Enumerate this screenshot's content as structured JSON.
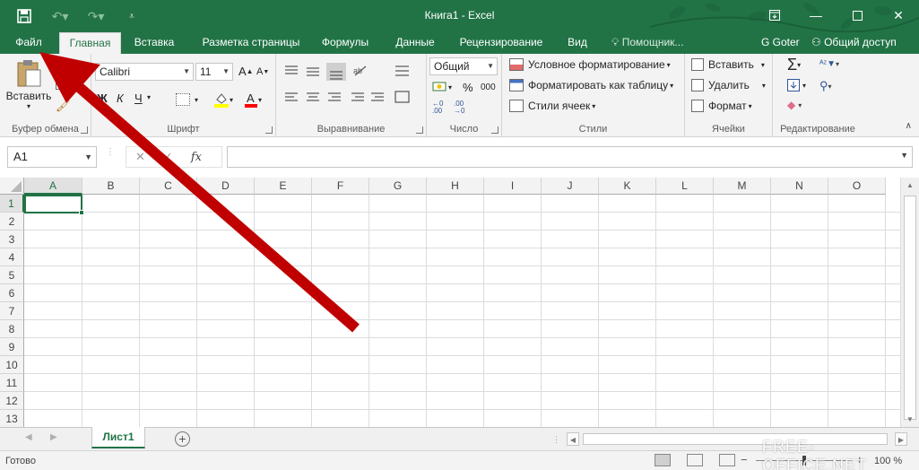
{
  "title_bar": {
    "title": "Книга1 - Excel",
    "save_icon": "save-icon",
    "undo_icon": "undo-icon",
    "redo_icon": "redo-icon",
    "customize_icon": "customize-qat-icon",
    "accent": "#217346"
  },
  "tabs": {
    "file": "Файл",
    "home": "Главная",
    "insert": "Вставка",
    "page_layout": "Разметка страницы",
    "formulas": "Формулы",
    "data": "Данные",
    "review": "Рецензирование",
    "view": "Вид",
    "tell_me": "Помощник...",
    "user": "G Goter",
    "share": "Общий доступ"
  },
  "ribbon": {
    "clipboard": {
      "paste": "Вставить",
      "label": "Буфер обмена"
    },
    "font": {
      "name": "Calibri",
      "size": "11",
      "bold": "Ж",
      "italic": "К",
      "underline": "Ч",
      "label": "Шрифт"
    },
    "alignment": {
      "label": "Выравнивание"
    },
    "number": {
      "format": "Общий",
      "percent": "%",
      "thousands": "000",
      "label": "Число"
    },
    "styles": {
      "conditional": "Условное форматирование",
      "format_table": "Форматировать как таблицу",
      "cell_styles": "Стили ячеек",
      "label": "Стили"
    },
    "cells": {
      "insert": "Вставить",
      "delete": "Удалить",
      "format": "Формат",
      "label": "Ячейки"
    },
    "editing": {
      "label": "Редактирование"
    }
  },
  "formula_bar": {
    "name_box": "A1",
    "fx": "fx",
    "value": ""
  },
  "grid": {
    "columns": [
      "A",
      "B",
      "C",
      "D",
      "E",
      "F",
      "G",
      "H",
      "I",
      "J",
      "K",
      "L",
      "M",
      "N",
      "O"
    ],
    "rows": [
      "1",
      "2",
      "3",
      "4",
      "5",
      "6",
      "7",
      "8",
      "9",
      "10",
      "11",
      "12",
      "13"
    ],
    "active_cell": "A1"
  },
  "sheets": {
    "tabs": [
      "Лист1"
    ],
    "active": "Лист1"
  },
  "status": {
    "text": "Готово",
    "zoom": "100 %"
  },
  "watermark": "FREE-OFFICE.NET",
  "annotation_arrow_color": "#c00000"
}
